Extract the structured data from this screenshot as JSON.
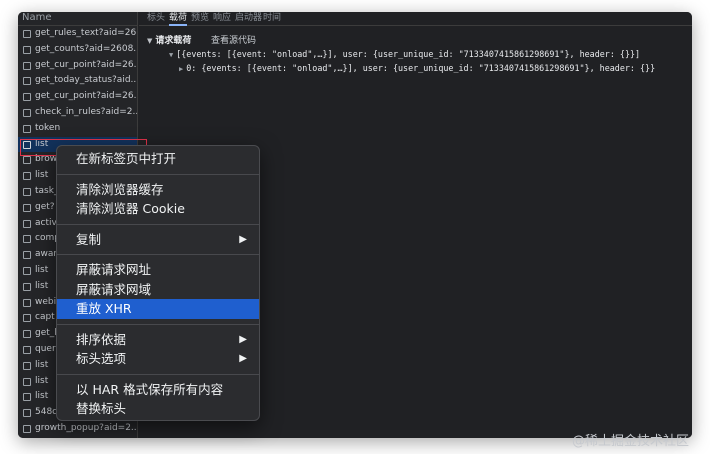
{
  "list": {
    "header": "Name",
    "rows": [
      "get_rules_text?aid=26...",
      "get_counts?aid=2608...",
      "get_cur_point?aid=26...",
      "get_today_status?aid...",
      "get_cur_point?aid=26...",
      "check_in_rules?aid=2...",
      "token",
      "list",
      "brow",
      "list",
      "task_",
      "get?",
      "activ",
      "comp",
      "awar",
      "list",
      "list",
      "webi",
      "capt",
      "get_l",
      "quer",
      "list",
      "list",
      "list",
      "548c",
      "growth_popup?aid=2..."
    ],
    "selected_index": 7
  },
  "detail": {
    "tabs": [
      "标头",
      "载荷",
      "预览",
      "响应",
      "启动器",
      "时间"
    ],
    "active_tab_index": 1,
    "section_title": "请求载荷",
    "view_source": "查看源代码",
    "payload_line1": "[{events: [{event: \"onload\",…}], user: {user_unique_id: \"7133407415861298691\"}, header: {}}]",
    "payload_line2_index": "0",
    "payload_line2": ": {events: [{event: \"onload\",…}], user: {user_unique_id: \"7133407415861298691\"}, header: {}}"
  },
  "context_menu": {
    "groups": [
      [
        {
          "label": "在新标签页中打开",
          "submenu": false
        }
      ],
      [
        {
          "label": "清除浏览器缓存",
          "submenu": false
        },
        {
          "label": "清除浏览器 Cookie",
          "submenu": false
        }
      ],
      [
        {
          "label": "复制",
          "submenu": true
        }
      ],
      [
        {
          "label": "屏蔽请求网址",
          "submenu": false
        },
        {
          "label": "屏蔽请求网域",
          "submenu": false
        },
        {
          "label": "重放 XHR",
          "submenu": false,
          "active": true
        }
      ],
      [
        {
          "label": "排序依据",
          "submenu": true
        },
        {
          "label": "标头选项",
          "submenu": true
        }
      ],
      [
        {
          "label": "以 HAR 格式保存所有内容",
          "submenu": false
        },
        {
          "label": "替换标头",
          "submenu": false
        }
      ]
    ],
    "submenu_arrow": "▶"
  },
  "watermark": "@稀土掘金技术社区",
  "colors": {
    "menu_active": "#1f5fcf",
    "highlight_border": "#e0334b",
    "selected_row": "#12325c"
  }
}
